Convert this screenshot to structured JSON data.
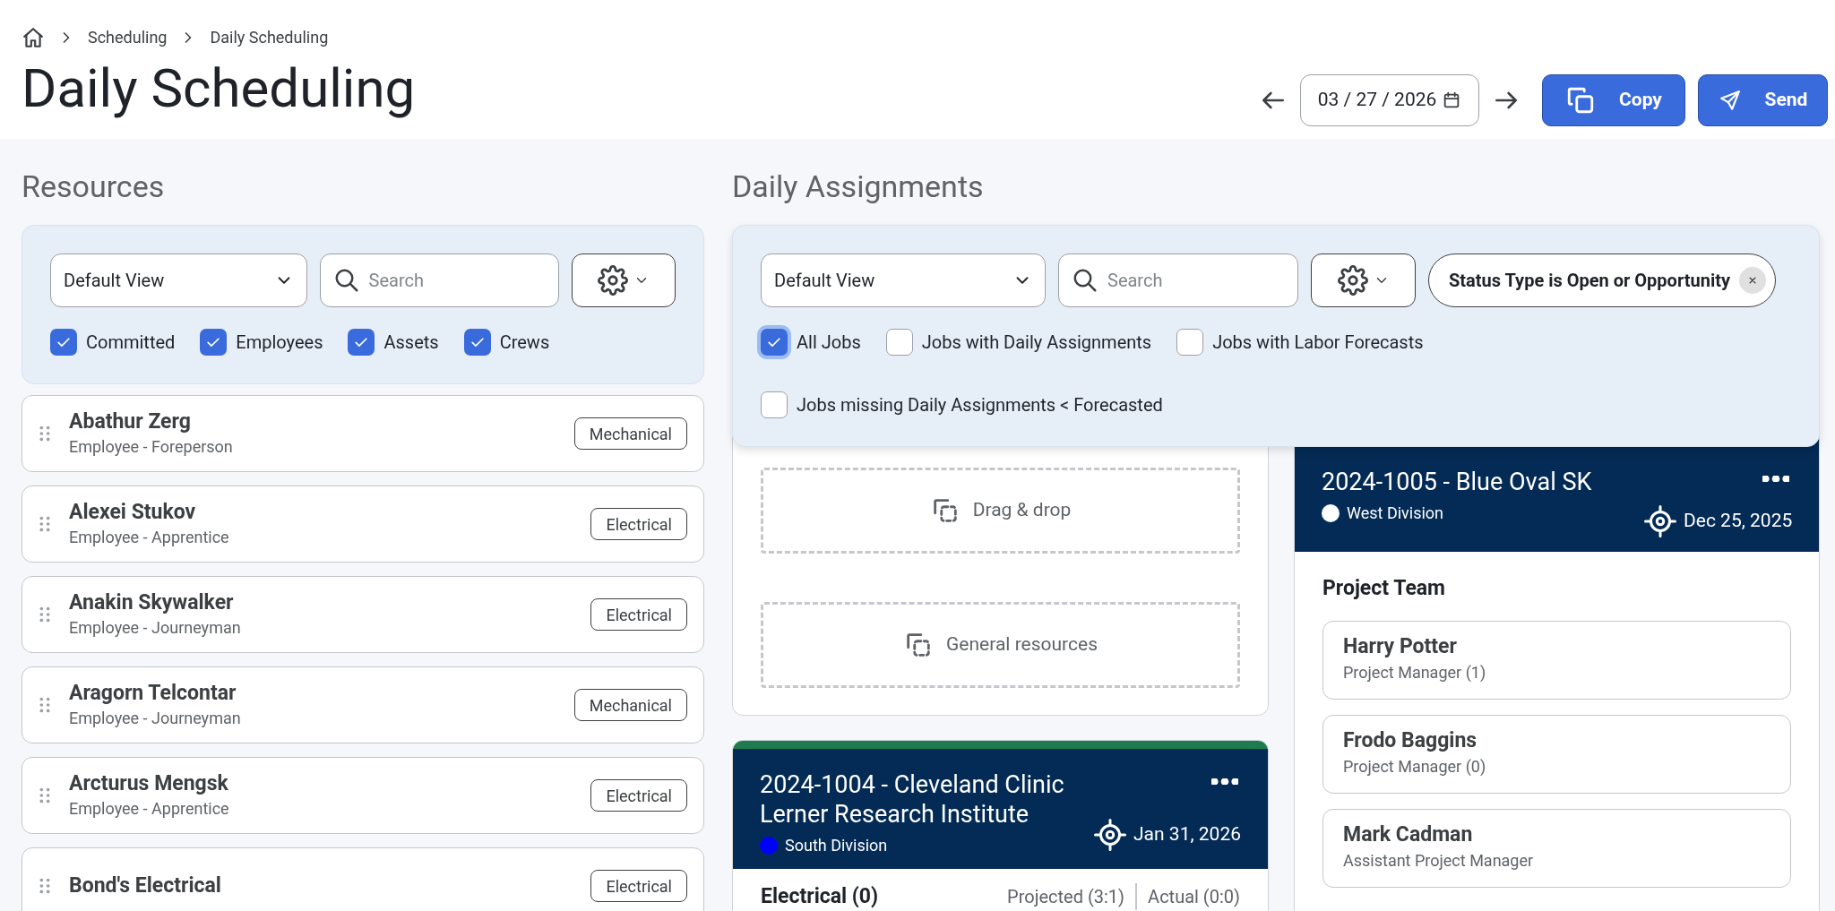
{
  "breadcrumb": [
    "Scheduling",
    "Daily Scheduling"
  ],
  "page_title": "Daily Scheduling",
  "date_field": {
    "value": "03 / 27 / 2026"
  },
  "actions": [
    {
      "kind": "copy",
      "label": "Copy"
    },
    {
      "kind": "send",
      "label": "Send"
    }
  ],
  "resources": {
    "heading": "Resources",
    "view_select": "Default View",
    "search": {
      "placeholder": "Search"
    },
    "filters": [
      {
        "label": "Committed",
        "checked": true
      },
      {
        "label": "Employees",
        "checked": true
      },
      {
        "label": "Assets",
        "checked": true
      },
      {
        "label": "Crews",
        "checked": true
      }
    ],
    "items": [
      {
        "name": "Abathur Zerg",
        "role": "Employee - Foreperson",
        "tag": "Mechanical"
      },
      {
        "name": "Alexei Stukov",
        "role": "Employee - Apprentice",
        "tag": "Electrical"
      },
      {
        "name": "Anakin Skywalker",
        "role": "Employee - Journeyman",
        "tag": "Electrical"
      },
      {
        "name": "Aragorn Telcontar",
        "role": "Employee - Journeyman",
        "tag": "Mechanical"
      },
      {
        "name": "Arcturus Mengsk",
        "role": "Employee - Apprentice",
        "tag": "Electrical"
      },
      {
        "name": "Bond's Electrical",
        "tag": "Electrical"
      }
    ]
  },
  "daily_assignments": {
    "heading": "Daily Assignments",
    "view_select": "Default View",
    "search": {
      "placeholder": "Search"
    },
    "filter_chip": "Status Type is Open or Opportunity",
    "filters": [
      {
        "label": "All Jobs",
        "checked": true,
        "focused": true
      },
      {
        "label": "Jobs with Daily Assignments",
        "checked": false,
        "focused": false
      },
      {
        "label": "Jobs with Labor Forecasts",
        "checked": false,
        "focused": false
      },
      {
        "label": "Jobs missing Daily Assignments < Forecasted",
        "checked": false,
        "focused": false
      }
    ],
    "drop_zones": [
      "Drag & drop",
      "General resources"
    ],
    "jobs": [
      {
        "title": "2024-1004 - Cleveland Clinic Lerner Research Institute",
        "division": "South Division",
        "color": "#0000ff",
        "date": "Jan 31, 2026",
        "section": {
          "title": "Electrical (0)",
          "projected": "Projected (3:1)",
          "actual": "Actual (0:0)"
        }
      },
      {
        "title": "2024-1005 - Blue Oval SK",
        "division": "West Division",
        "color": "#ffffff",
        "date": "Dec 25, 2025",
        "team_title": "Project Team",
        "team": [
          {
            "name": "Harry Potter",
            "role": "Project Manager (1)"
          },
          {
            "name": "Frodo Baggins",
            "role": "Project Manager (0)"
          },
          {
            "name": "Mark Cadman",
            "role": "Assistant Project Manager"
          }
        ]
      }
    ]
  }
}
